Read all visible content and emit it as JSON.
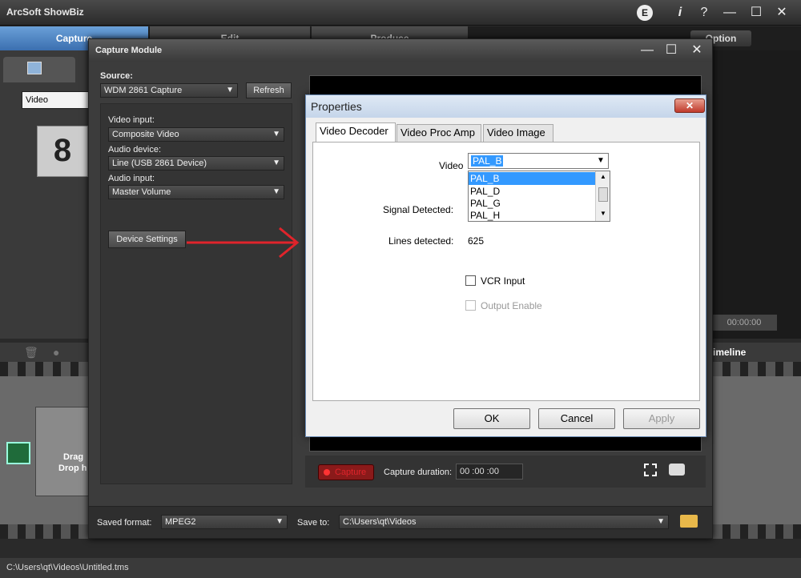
{
  "app": {
    "title": "ArcSoft ShowBiz",
    "e_badge": "E",
    "help_info": "i",
    "help_q": "?",
    "minimize": "—",
    "maximize": "☐",
    "close": "✕"
  },
  "tabs": [
    {
      "label": "Capture"
    },
    {
      "label": "Edit"
    },
    {
      "label": "Produce"
    },
    {
      "label": "Option"
    }
  ],
  "left_panel": {
    "video_select": "Video",
    "countdown": "8",
    "drag_label_1": "Drag",
    "drag_label_2": "Drop h"
  },
  "right_panel": {
    "timecode": "00:00:00",
    "timeline_label": "imeline"
  },
  "statusbar": {
    "path": "C:\\Users\\qt\\Videos\\Untitled.tms"
  },
  "capture_module": {
    "title": "Capture Module",
    "source_label": "Source:",
    "source_value": "WDM 2861 Capture",
    "refresh": "Refresh",
    "video_input_label": "Video input:",
    "video_input_value": "Composite Video",
    "audio_device_label": "Audio device:",
    "audio_device_value": "Line (USB 2861 Device)",
    "audio_input_label": "Audio input:",
    "audio_input_value": "Master Volume",
    "device_settings": "Device Settings",
    "capture_btn": "Capture",
    "capture_duration_label": "Capture duration:",
    "capture_duration_value": "00 :00 :00",
    "saved_format_label": "Saved format:",
    "saved_format_value": "MPEG2",
    "save_to_label": "Save to:",
    "save_to_value": "C:\\Users\\qt\\Videos"
  },
  "properties": {
    "title": "Properties",
    "close": "✕",
    "tabs": [
      {
        "label": "Video Decoder"
      },
      {
        "label": "Video Proc Amp"
      },
      {
        "label": "Video Image"
      }
    ],
    "video_label": "Video",
    "video_value": "PAL_B",
    "options": [
      "PAL_B",
      "PAL_D",
      "PAL_G",
      "PAL_H"
    ],
    "signal_detected_label": "Signal Detected:",
    "lines_detected_label": "Lines detected:",
    "lines_detected_value": "625",
    "vcr_input": "VCR Input",
    "output_enable": "Output Enable",
    "ok": "OK",
    "cancel": "Cancel",
    "apply": "Apply"
  },
  "colors": {
    "accent": "#3b6fb0",
    "arrow": "#e0242b",
    "selection": "#3399ff"
  }
}
